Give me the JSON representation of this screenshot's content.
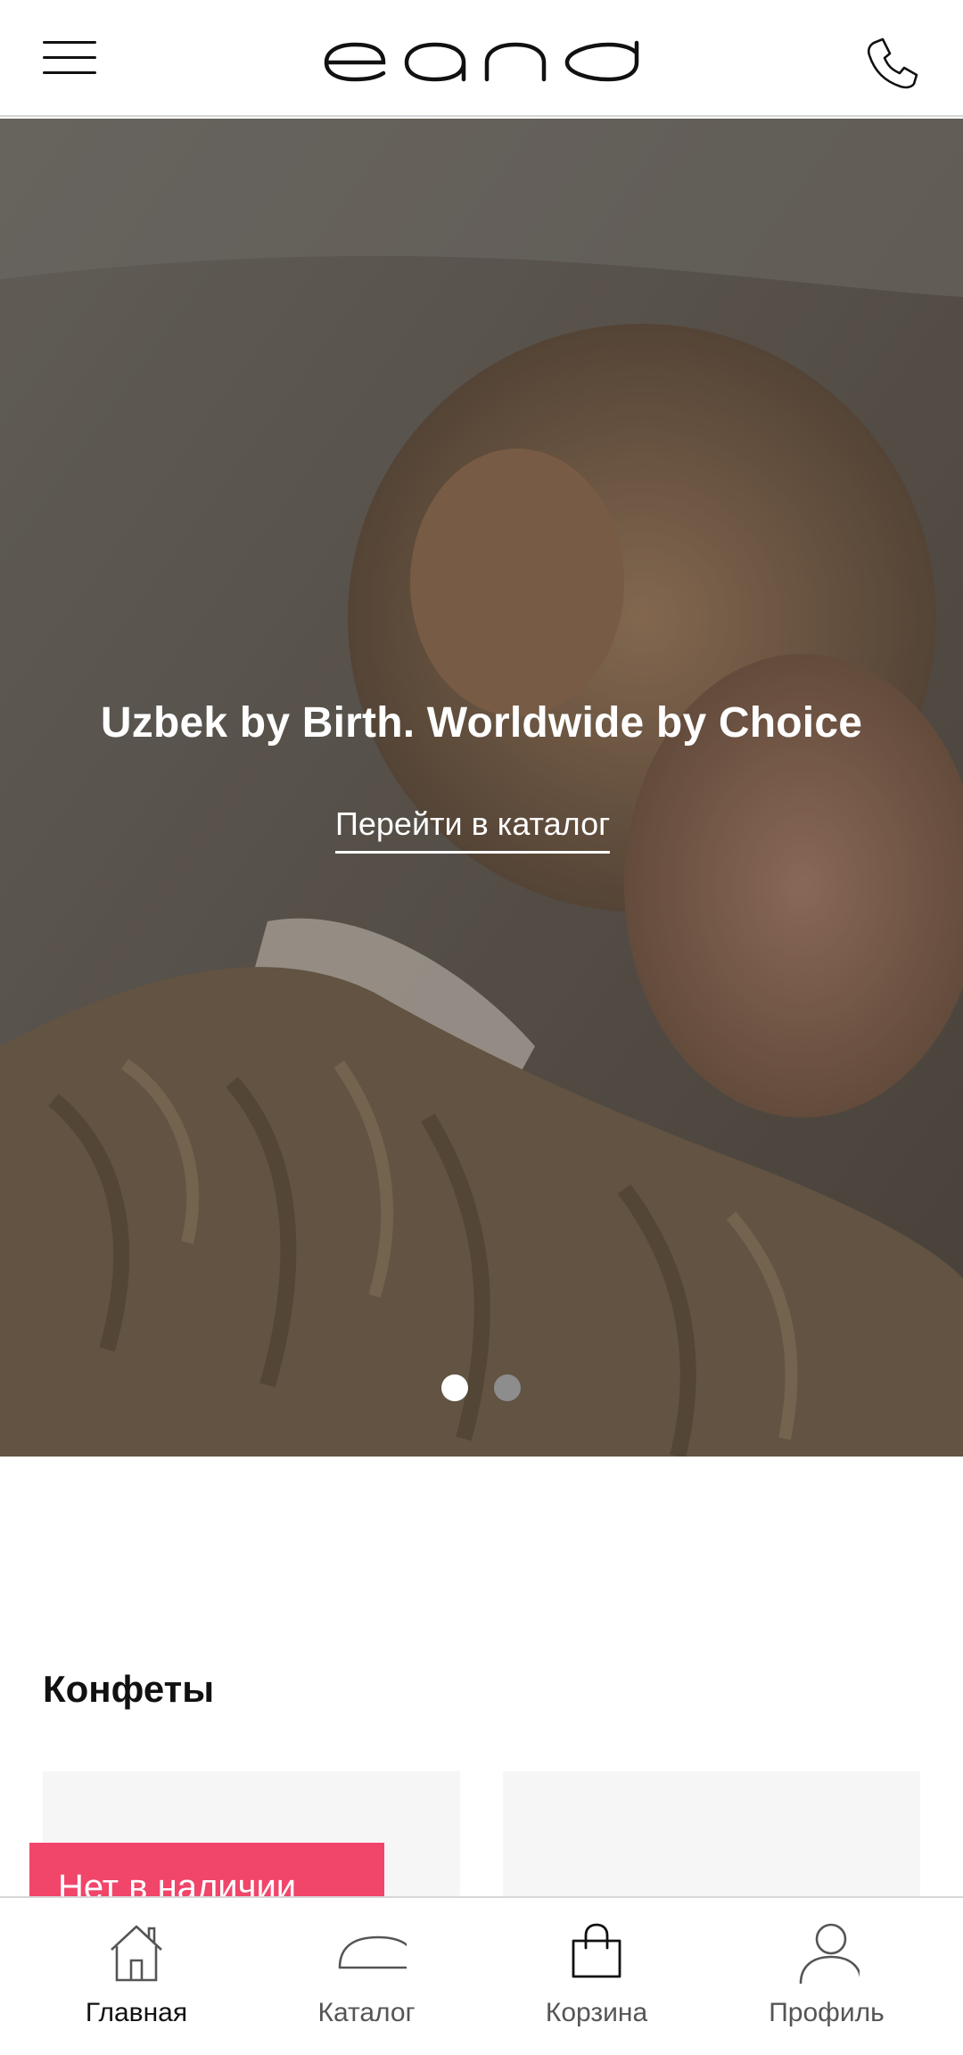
{
  "header": {
    "menu_icon": "hamburger-menu-icon",
    "logo_text": "eand",
    "phone_icon": "phone-icon"
  },
  "hero": {
    "title": "Uzbek by Birth. Worldwide by Choice",
    "cta_label": "Перейти в каталог",
    "slides_total": 2,
    "active_slide": 1
  },
  "section": {
    "title": "Конфеты"
  },
  "products": [
    {
      "badge": "Нет в наличии"
    },
    {
      "badge": ""
    }
  ],
  "bottom_nav": {
    "items": [
      {
        "label": "Главная",
        "icon": "home-icon",
        "active": true
      },
      {
        "label": "Каталог",
        "icon": "catalog-dome-icon",
        "active": false
      },
      {
        "label": "Корзина",
        "icon": "shopping-bag-icon",
        "active": false
      },
      {
        "label": "Профиль",
        "icon": "profile-icon",
        "active": false
      }
    ]
  },
  "colors": {
    "badge_bg": "#f1456a",
    "dot_active": "#ffffff",
    "dot_inactive": "#8d8d8d",
    "card_bg": "#f6f6f6"
  }
}
